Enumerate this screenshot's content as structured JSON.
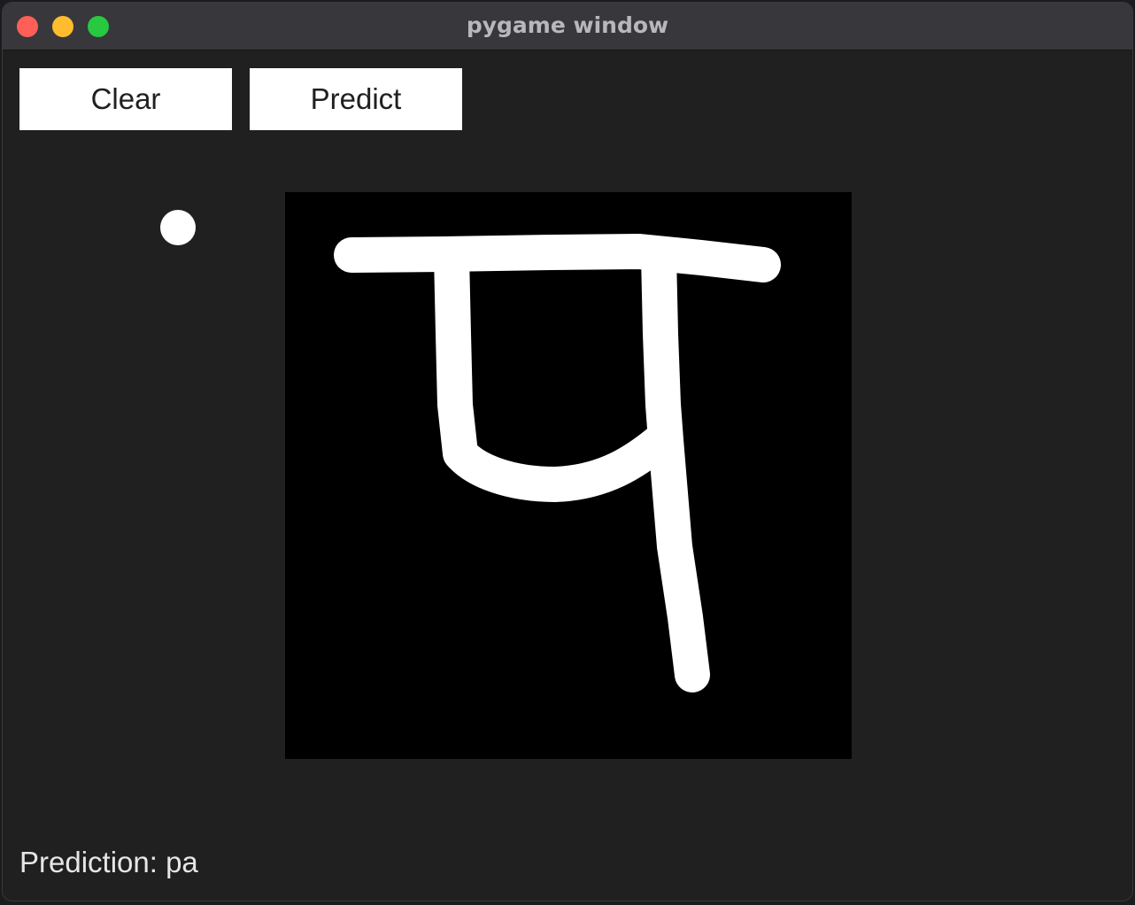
{
  "window": {
    "title": "pygame window"
  },
  "toolbar": {
    "clear_label": "Clear",
    "predict_label": "Predict"
  },
  "drawing_canvas": {
    "background": "#000000",
    "stroke_color": "#ffffff",
    "glyph": "प"
  },
  "status": {
    "prediction_text": "Prediction: pa"
  },
  "colors": {
    "window_bg": "#202020",
    "titlebar_bg": "#38373c",
    "button_bg": "#ffffff",
    "close": "#fe5f57",
    "minimize": "#febc2e",
    "maximize": "#28c840"
  }
}
